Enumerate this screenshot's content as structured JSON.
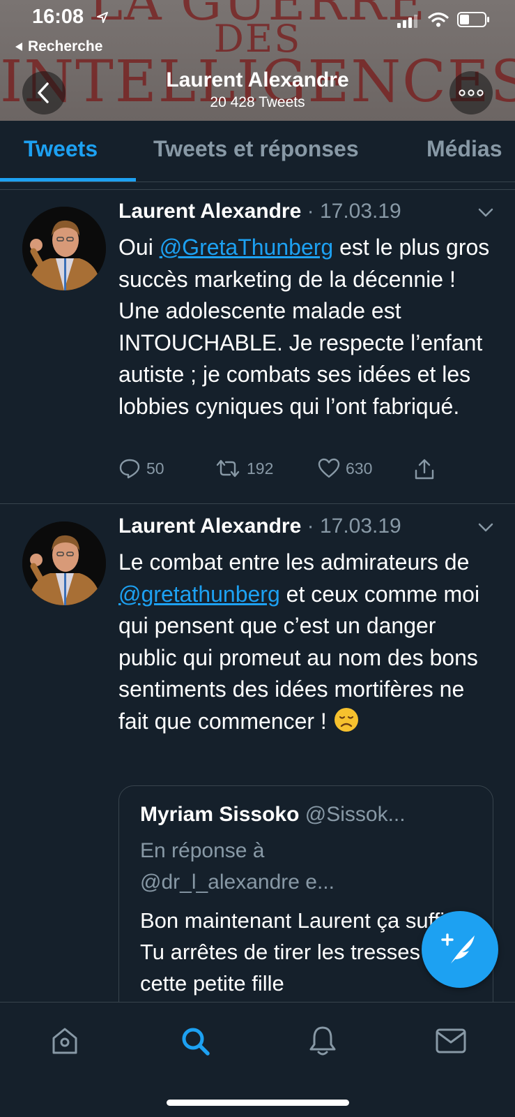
{
  "status_bar": {
    "time": "16:08",
    "back_app_label": "Recherche"
  },
  "header": {
    "banner_line1": "LA GUERRE",
    "banner_line2": "DES",
    "banner_line3": "INTELLIGENCES",
    "profile_name": "Laurent Alexandre",
    "tweet_count": "20 428 Tweets"
  },
  "tabs": [
    {
      "label": "Tweets",
      "active": true
    },
    {
      "label": "Tweets et réponses",
      "active": false
    },
    {
      "label": "Médias",
      "active": false
    }
  ],
  "tweets": [
    {
      "author": "Laurent Alexandre",
      "separator": " · ",
      "date": "17.03.19",
      "text_before": "Oui ",
      "mention": "@GretaThunberg",
      "text_after": " est le plus gros succès marketing de la décennie ! Une adolescente malade est INTOUCHABLE. Je respecte l’enfant autiste ; je combats ses idées et les lobbies cyniques qui l’ont fabriqué.",
      "replies": "50",
      "retweets": "192",
      "likes": "630"
    },
    {
      "author": "Laurent Alexandre",
      "separator": " · ",
      "date": "17.03.19",
      "text_before": "Le combat entre les admirateurs de ",
      "mention": "@gretathunberg",
      "text_after": " et ceux comme moi qui pensent que c’est un danger public qui promeut au nom des bons sentiments des idées mortifères ne fait que commencer ! ",
      "quote": {
        "name": "Myriam Sissoko",
        "handle": " @Sissok...",
        "reply_to_line1": "En réponse à",
        "reply_to_line2": "@dr_l_alexandre e...",
        "body": "Bon maintenant Laurent ça suffit ! Tu arrêtes de tirer les tresses de cette petite fille"
      }
    }
  ],
  "icons": {
    "back": "chevron-left-icon",
    "more": "more-icon",
    "compose": "compose-tweet-icon",
    "nav": [
      "home-icon",
      "search-icon",
      "notifications-icon",
      "messages-icon"
    ]
  },
  "colors": {
    "background": "#15202b",
    "accent": "#1da1f2",
    "muted": "#8899a6",
    "divider": "#38444d"
  }
}
